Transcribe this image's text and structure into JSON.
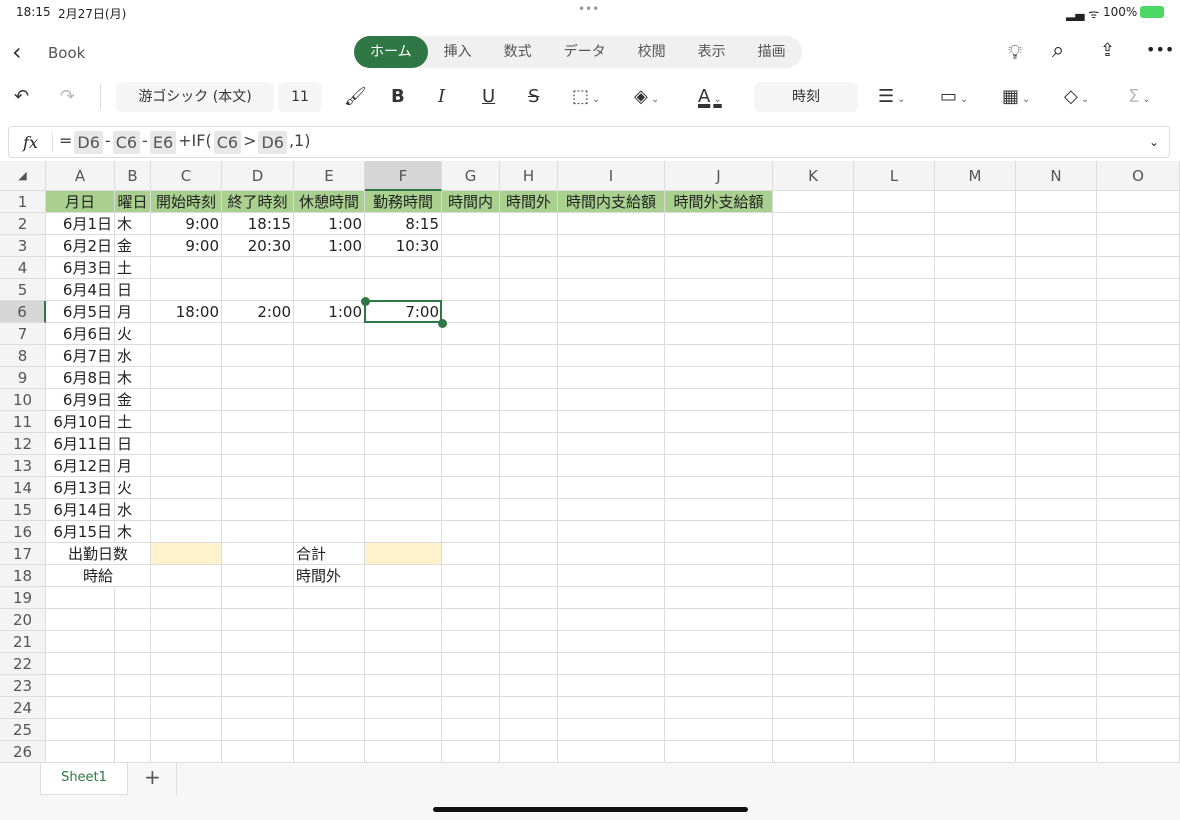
{
  "status": {
    "time": "18:15",
    "date": "2月27日(月)",
    "battery": "100%"
  },
  "ribbon": {
    "back_label": "Book",
    "tabs": [
      "ホーム",
      "挿入",
      "数式",
      "データ",
      "校閲",
      "表示",
      "描画"
    ],
    "active_tab": 0,
    "font_name": "游ゴシック (本文)",
    "font_size": "11",
    "number_format": "時刻"
  },
  "formula": {
    "fx": "fx",
    "parts": [
      "=",
      "D6",
      "-",
      "C6",
      "-",
      "E6",
      "+IF(",
      "C6",
      ">",
      "D6",
      ",1)"
    ]
  },
  "grid": {
    "columns": [
      "A",
      "B",
      "C",
      "D",
      "E",
      "F",
      "G",
      "H",
      "I",
      "J",
      "K",
      "L",
      "M",
      "N",
      "O"
    ],
    "selected_column": "F",
    "selected_row": 6,
    "header_fill": "#a9d08e",
    "highlight_fill": "#fff2cc",
    "accent": "#2f7846",
    "rows": [
      [
        "月日",
        "曜日",
        "開始時刻",
        "終了時刻",
        "休憩時間",
        "勤務時間",
        "時間内",
        "時間外",
        "時間内支給額",
        "時間外支給額"
      ],
      [
        "6月1日",
        "木",
        "9:00",
        "18:15",
        "1:00",
        "8:15"
      ],
      [
        "6月2日",
        "金",
        "9:00",
        "20:30",
        "1:00",
        "10:30"
      ],
      [
        "6月3日",
        "土"
      ],
      [
        "6月4日",
        "日"
      ],
      [
        "6月5日",
        "月",
        "18:00",
        "2:00",
        "1:00",
        "7:00"
      ],
      [
        "6月6日",
        "火"
      ],
      [
        "6月7日",
        "水"
      ],
      [
        "6月8日",
        "木"
      ],
      [
        "6月9日",
        "金"
      ],
      [
        "6月10日",
        "土"
      ],
      [
        "6月11日",
        "日"
      ],
      [
        "6月12日",
        "月"
      ],
      [
        "6月13日",
        "火"
      ],
      [
        "6月14日",
        "水"
      ],
      [
        "6月15日",
        "木"
      ],
      [
        "出勤日数",
        "",
        "",
        "",
        "合計",
        ""
      ],
      [
        "時給",
        "",
        "",
        "",
        "時間外"
      ]
    ],
    "row_count": 26
  },
  "sheets": {
    "tabs": [
      "Sheet1"
    ],
    "add": "+"
  }
}
